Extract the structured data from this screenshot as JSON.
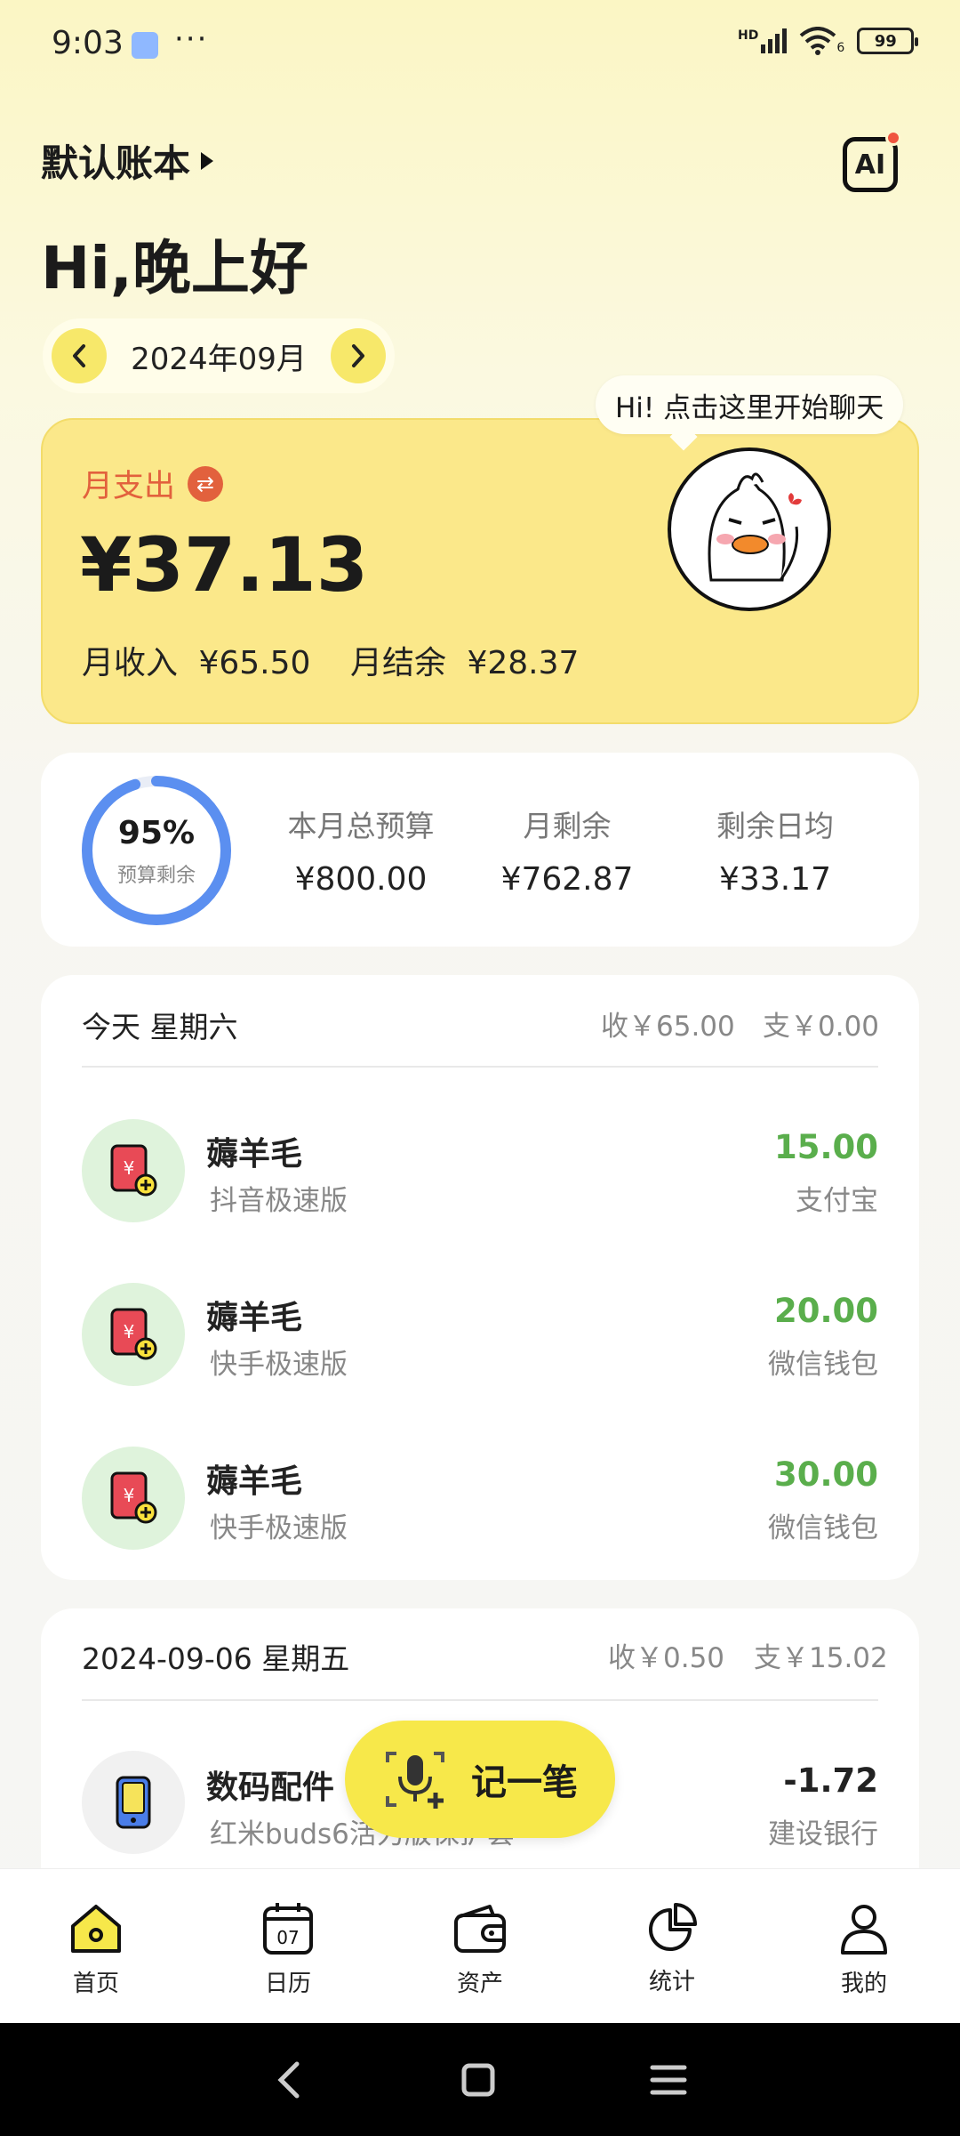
{
  "status": {
    "time": "9:03",
    "dots": "···",
    "signal": "HD",
    "wifi_num": "6",
    "battery": "99"
  },
  "header": {
    "book_name": "默认账本",
    "ai_label": "AI",
    "greeting": "Hi,晚上好",
    "month": "2024年09月"
  },
  "bubble": {
    "text": "Hi! 点击这里开始聊天"
  },
  "summary": {
    "expense_label": "月支出",
    "expense_amount": "¥37.13",
    "income_label": "月收入",
    "income_amount": "¥65.50",
    "balance_label": "月结余",
    "balance_amount": "¥28.37"
  },
  "budget": {
    "percent": "95%",
    "percent_value": 0.95,
    "percent_caption": "预算剩余",
    "total_label": "本月总预算",
    "total_value": "¥800.00",
    "remain_label": "月剩余",
    "remain_value": "¥762.87",
    "daily_label": "剩余日均",
    "daily_value": "¥33.17"
  },
  "today": {
    "title": "今天 星期六",
    "income": "收￥65.00",
    "expense": "支￥0.00",
    "items": [
      {
        "title": "薅羊毛",
        "sub": "抖音极速版",
        "amount": "15.00",
        "account": "支付宝"
      },
      {
        "title": "薅羊毛",
        "sub": "快手极速版",
        "amount": "20.00",
        "account": "微信钱包"
      },
      {
        "title": "薅羊毛",
        "sub": "快手极速版",
        "amount": "30.00",
        "account": "微信钱包"
      }
    ]
  },
  "day2": {
    "title": "2024-09-06 星期五",
    "income": "收￥0.50",
    "expense": "支￥15.02",
    "items": [
      {
        "title": "数码配件",
        "sub": "红米buds6活力版保护套",
        "amount": "-1.72",
        "account": "建设银行"
      }
    ]
  },
  "fab": {
    "label": "记一笔"
  },
  "nav": [
    {
      "label": "首页",
      "icon": "home-icon"
    },
    {
      "label": "日历",
      "icon": "calendar-icon",
      "badge": "07"
    },
    {
      "label": "资产",
      "icon": "wallet-icon"
    },
    {
      "label": "统计",
      "icon": "pie-chart-icon"
    },
    {
      "label": "我的",
      "icon": "profile-icon"
    }
  ],
  "colors": {
    "accent_yellow": "#f7e84a",
    "card_yellow": "#fbe88a",
    "expense_orange": "#e2613d",
    "income_green": "#5aae4c",
    "ring_blue": "#5b8ff0"
  }
}
